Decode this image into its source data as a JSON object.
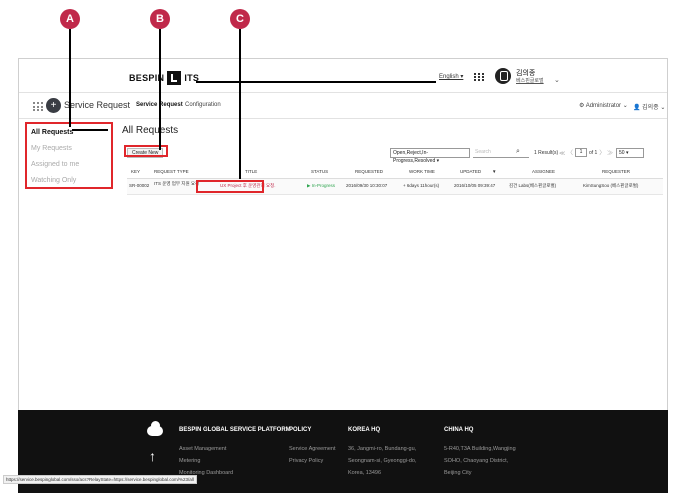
{
  "markers": [
    "A",
    "B",
    "C"
  ],
  "header": {
    "brand_left": "BESPIN",
    "brand_right": "ITS",
    "language": "English ▾",
    "user_name": "김의종",
    "user_org": "베스핀글로벌",
    "caret": "⌄"
  },
  "subnav": {
    "app_name": "Service Request",
    "tabs": [
      "Service Request",
      "Configuration"
    ],
    "admin": "⚙ Administrator ⌄",
    "profile": "👤 김의종 ⌄"
  },
  "sidebar": {
    "items": [
      "All Requests",
      "My Requests",
      "Assigned to me",
      "Watching Only"
    ]
  },
  "main": {
    "title": "All Requests",
    "create_label": "Create New",
    "status_filter": "Open,Reject,In-Progress,Resolved ▾",
    "search_placeholder": "Search",
    "results": "1 Result(s)",
    "pager_prev": "≪ 〈",
    "page": "1",
    "page_of": "of 1",
    "pager_next": "〉 ≫",
    "page_size": "50 ▾"
  },
  "table": {
    "columns": [
      "KEY",
      "REQUEST TYPE",
      "TITLE",
      "STATUS",
      "REQUESTED",
      "WORK TIME",
      "UPDATED",
      "▼",
      "ASSIGNEE",
      "REQUESTER"
    ],
    "rows": [
      {
        "key": "SR-00002",
        "type": "ITS 운영 업무 지원 요청",
        "title": "UX Project 후 운영관리 요청.",
        "status": "▶ In-Progress",
        "requested": "2016/09/30 10:30:07",
        "work_time": "+ 6days 11hour(s)",
        "updated": "2016/10/05 09:39:47",
        "assignee": "김건 Labs(베스핀글로벌)",
        "requester": "KimSungSoo (베스핀글로벌)"
      }
    ]
  },
  "footer": {
    "platform_heading": "BESPIN GLOBAL SERVICE PLATFORM",
    "platform_items": [
      "Asset Management",
      "Metering",
      "Monitoring Dashboard"
    ],
    "policy_heading": "POLICY",
    "policy_items": [
      "Service Agreement",
      "Privacy Policy"
    ],
    "korea_heading": "KOREA HQ",
    "korea_lines": [
      "36, Jangmi-ro, Bundang-gu,",
      "Seongnam-si, Gyeonggi-do,",
      "Korea, 13496"
    ],
    "china_heading": "CHINA HQ",
    "china_lines": [
      "5-R40,T3A Building,Wangjing",
      "SOHO, Chaoyang District,",
      "Beijing City"
    ]
  },
  "status_url": "https://service.bespinglobal.com/sso/acs?RelayState=https://service.bespinglobal.com/%23/all",
  "colors": {
    "accent": "#c0294a",
    "highlight": "#e0262b",
    "footer_bg": "#111111"
  }
}
